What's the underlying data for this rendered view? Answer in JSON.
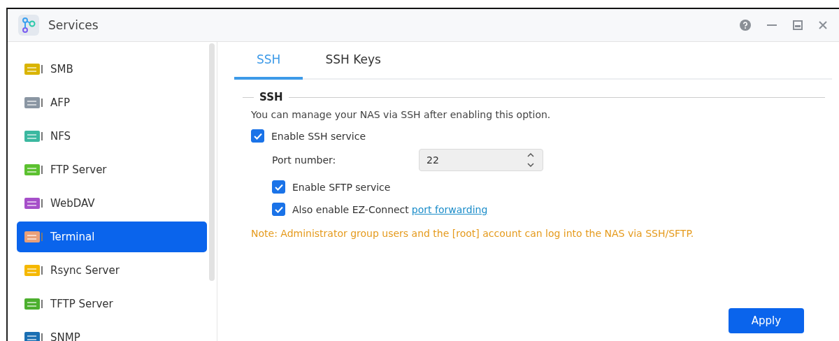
{
  "window": {
    "title": "Services"
  },
  "sidebar": {
    "items": [
      {
        "label": "SMB",
        "selected": false
      },
      {
        "label": "AFP",
        "selected": false
      },
      {
        "label": "NFS",
        "selected": false
      },
      {
        "label": "FTP Server",
        "selected": false
      },
      {
        "label": "WebDAV",
        "selected": false
      },
      {
        "label": "Terminal",
        "selected": true
      },
      {
        "label": "Rsync Server",
        "selected": false
      },
      {
        "label": "TFTP Server",
        "selected": false
      },
      {
        "label": "SNMP",
        "selected": false
      }
    ]
  },
  "tabs": [
    {
      "label": "SSH",
      "selected": true
    },
    {
      "label": "SSH Keys",
      "selected": false
    }
  ],
  "section": {
    "title": "SSH",
    "description": "You can manage your NAS via SSH after enabling this option.",
    "enable_ssh": {
      "label": "Enable SSH service",
      "checked": true
    },
    "port": {
      "label": "Port number:",
      "value": "22"
    },
    "enable_sftp": {
      "label": "Enable SFTP service",
      "checked": true
    },
    "ez_connect": {
      "label": "Also enable EZ-Connect",
      "link": "port forwarding",
      "checked": true
    },
    "note": "Note: Administrator group users and the [root] account can log into the NAS via SSH/SFTP."
  },
  "buttons": {
    "apply": "Apply"
  }
}
